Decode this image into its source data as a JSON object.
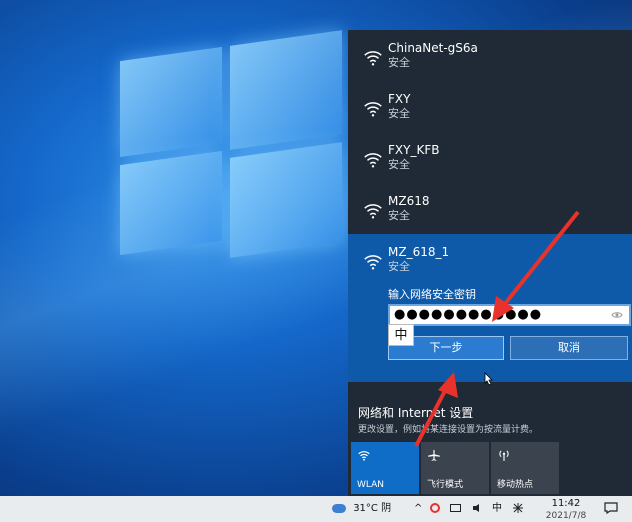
{
  "networks": [
    {
      "name": "ChinaNet-gS6a",
      "status": "安全"
    },
    {
      "name": "FXY",
      "status": "安全"
    },
    {
      "name": "FXY_KFB",
      "status": "安全"
    },
    {
      "name": "MZ618",
      "status": "安全"
    }
  ],
  "selected_network": {
    "name": "MZ_618_1",
    "status": "安全",
    "key_label": "输入网络安全密钥",
    "password_mask": "●●●●●●●●●●●●",
    "ime_indicator": "中",
    "next_label": "下一步",
    "cancel_label": "取消"
  },
  "settings": {
    "title": "网络和 Internet 设置",
    "subtitle": "更改设置，例如将某连接设置为按流量计费。"
  },
  "quick_actions": [
    {
      "label": "WLAN",
      "icon": "wifi-icon",
      "active": true
    },
    {
      "label": "飞行模式",
      "icon": "airplane-icon",
      "active": false
    },
    {
      "label": "移动热点",
      "icon": "hotspot-icon",
      "active": false
    }
  ],
  "taskbar": {
    "weather": "31°C 阴",
    "ime": "中",
    "time": "11:42",
    "date": "2021/7/8"
  },
  "colors": {
    "flyout_bg": "#1f2a36",
    "selected_bg": "#0f5aa8",
    "accent": "#0f6cc7",
    "arrow": "#e8322b"
  }
}
